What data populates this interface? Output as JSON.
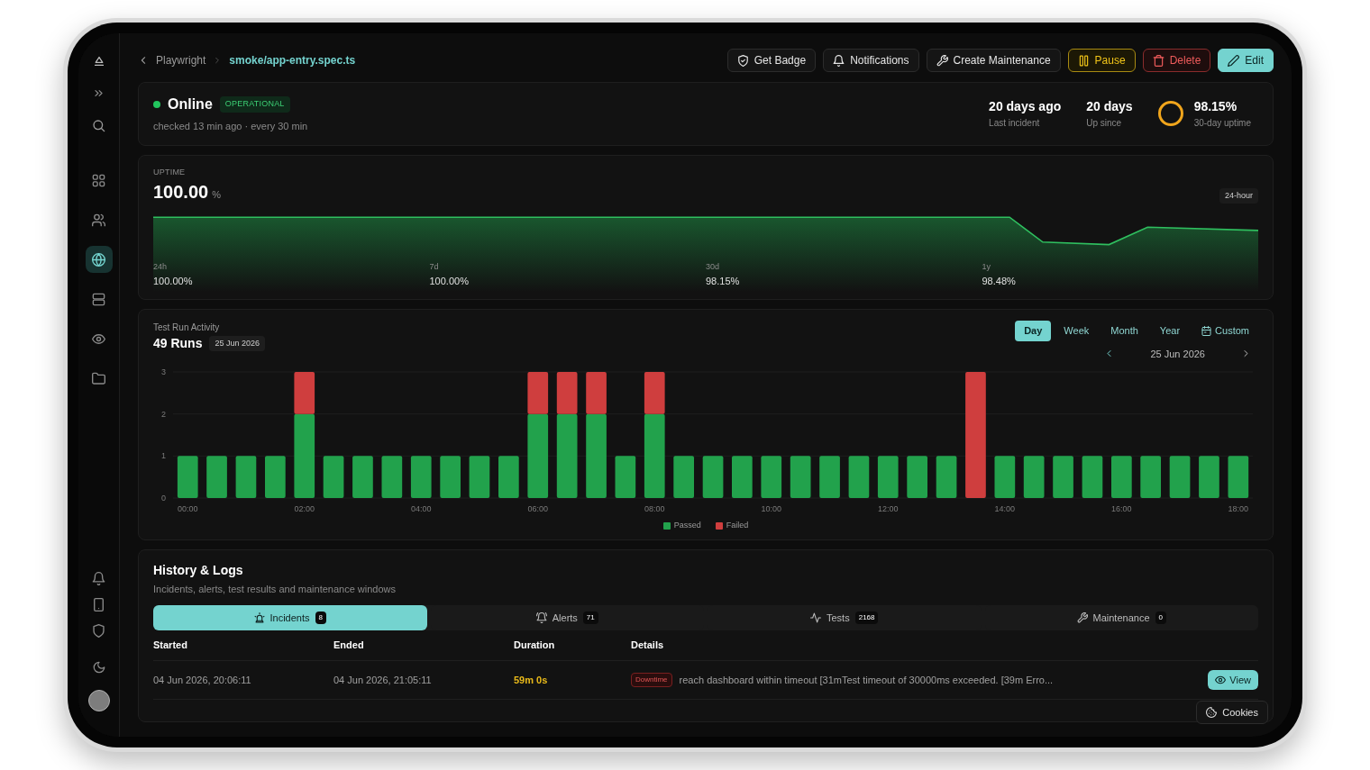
{
  "sidebar": {
    "nav_items": [
      {
        "selected": false
      },
      {
        "selected": false
      },
      {
        "selected": true
      },
      {
        "selected": false
      },
      {
        "selected": false
      },
      {
        "selected": false
      }
    ]
  },
  "breadcrumb": {
    "parent": "Playwright",
    "current": "smoke/app-entry.spec.ts"
  },
  "actions": [
    {
      "label": "Get Badge",
      "kind": "default"
    },
    {
      "label": "Notifications",
      "kind": "default"
    },
    {
      "label": "Create Maintenance",
      "kind": "default"
    },
    {
      "label": "Pause",
      "kind": "warning"
    },
    {
      "label": "Delete",
      "kind": "danger"
    },
    {
      "label": "Edit",
      "kind": "primary"
    }
  ],
  "status": {
    "label": "Online",
    "badge": "OPERATIONAL",
    "meta": "checked 13 min ago · every 30 min",
    "stats": [
      {
        "value": "20 days ago",
        "label": "Last incident"
      },
      {
        "value": "20 days",
        "label": "Up since"
      }
    ],
    "ring_stat": {
      "value": "98.15%",
      "label": "30-day uptime"
    }
  },
  "uptime": {
    "label": "UPTIME",
    "value": "100.00",
    "unit": "%",
    "range_badge": "24-hour",
    "periods": [
      {
        "label": "24h",
        "value": "100.00%"
      },
      {
        "label": "7d",
        "value": "100.00%"
      },
      {
        "label": "30d",
        "value": "98.15%"
      },
      {
        "label": "1y",
        "value": "98.48%"
      }
    ]
  },
  "activity": {
    "title": "Test Run Activity",
    "runs": "49 Runs",
    "date_badge": "25 Jun 2026",
    "ranges": [
      {
        "label": "Day",
        "kind": "preset",
        "selected": true
      },
      {
        "label": "Week",
        "kind": "preset",
        "selected": false
      },
      {
        "label": "Month",
        "kind": "preset",
        "selected": false
      },
      {
        "label": "Year",
        "kind": "preset",
        "selected": false
      },
      {
        "label": "Custom",
        "kind": "custom",
        "selected": false
      }
    ],
    "date": "25 Jun 2026",
    "chart_data": {
      "type": "bar",
      "stacked": true,
      "x": [
        0,
        0.5,
        1,
        1.5,
        2,
        2.5,
        3,
        3.5,
        4,
        4.5,
        5,
        5.5,
        6,
        6.5,
        7,
        7.5,
        8,
        8.5,
        9,
        9.5,
        10,
        10.5,
        11,
        11.5,
        12,
        12.5,
        13,
        13.5,
        14,
        14.5,
        15,
        15.5,
        16,
        16.5,
        17,
        17.5,
        18
      ],
      "xlim": [
        -0.25,
        18.25
      ],
      "xticks": [
        {
          "value": 0,
          "label": "00:00"
        },
        {
          "value": 2,
          "label": "02:00"
        },
        {
          "value": 4,
          "label": "04:00"
        },
        {
          "value": 6,
          "label": "06:00"
        },
        {
          "value": 8,
          "label": "08:00"
        },
        {
          "value": 10,
          "label": "10:00"
        },
        {
          "value": 12,
          "label": "12:00"
        },
        {
          "value": 14,
          "label": "14:00"
        },
        {
          "value": 16,
          "label": "16:00"
        },
        {
          "value": 18,
          "label": "18:00"
        }
      ],
      "ylim": [
        0,
        3
      ],
      "yticks": [
        0,
        1,
        2,
        3
      ],
      "series": [
        {
          "name": "Passed",
          "color": "#22a24c",
          "values": [
            1,
            1,
            1,
            1,
            2,
            1,
            1,
            1,
            1,
            1,
            1,
            1,
            2,
            2,
            2,
            1,
            2,
            1,
            1,
            1,
            1,
            1,
            1,
            1,
            1,
            1,
            1,
            0,
            1,
            1,
            1,
            1,
            1,
            1,
            1,
            1,
            1
          ]
        },
        {
          "name": "Failed",
          "color": "#cf3e3e",
          "values": [
            0,
            0,
            0,
            0,
            1,
            0,
            0,
            0,
            0,
            0,
            0,
            0,
            1,
            1,
            1,
            0,
            1,
            0,
            0,
            0,
            0,
            0,
            0,
            0,
            0,
            0,
            0,
            3,
            0,
            0,
            0,
            0,
            0,
            0,
            0,
            0,
            0
          ]
        }
      ]
    }
  },
  "history": {
    "title": "History & Logs",
    "subtitle": "Incidents, alerts, test results and maintenance windows",
    "tabs": [
      {
        "label": "Incidents",
        "count": "8",
        "selected": true
      },
      {
        "label": "Alerts",
        "count": "71",
        "selected": false
      },
      {
        "label": "Tests",
        "count": "2168",
        "selected": false
      },
      {
        "label": "Maintenance",
        "count": "0",
        "selected": false
      }
    ],
    "columns": [
      "Started",
      "Ended",
      "Duration",
      "Details"
    ],
    "rows": [
      {
        "started": "04 Jun 2026, 20:06:11",
        "ended": "04 Jun 2026, 21:05:11",
        "duration": "59m 0s",
        "tag": "Downtime",
        "details": "reach dashboard within timeout [31mTest timeout of 30000ms exceeded. [39m Erro...",
        "action": "View"
      }
    ]
  },
  "cookies": "Cookies"
}
